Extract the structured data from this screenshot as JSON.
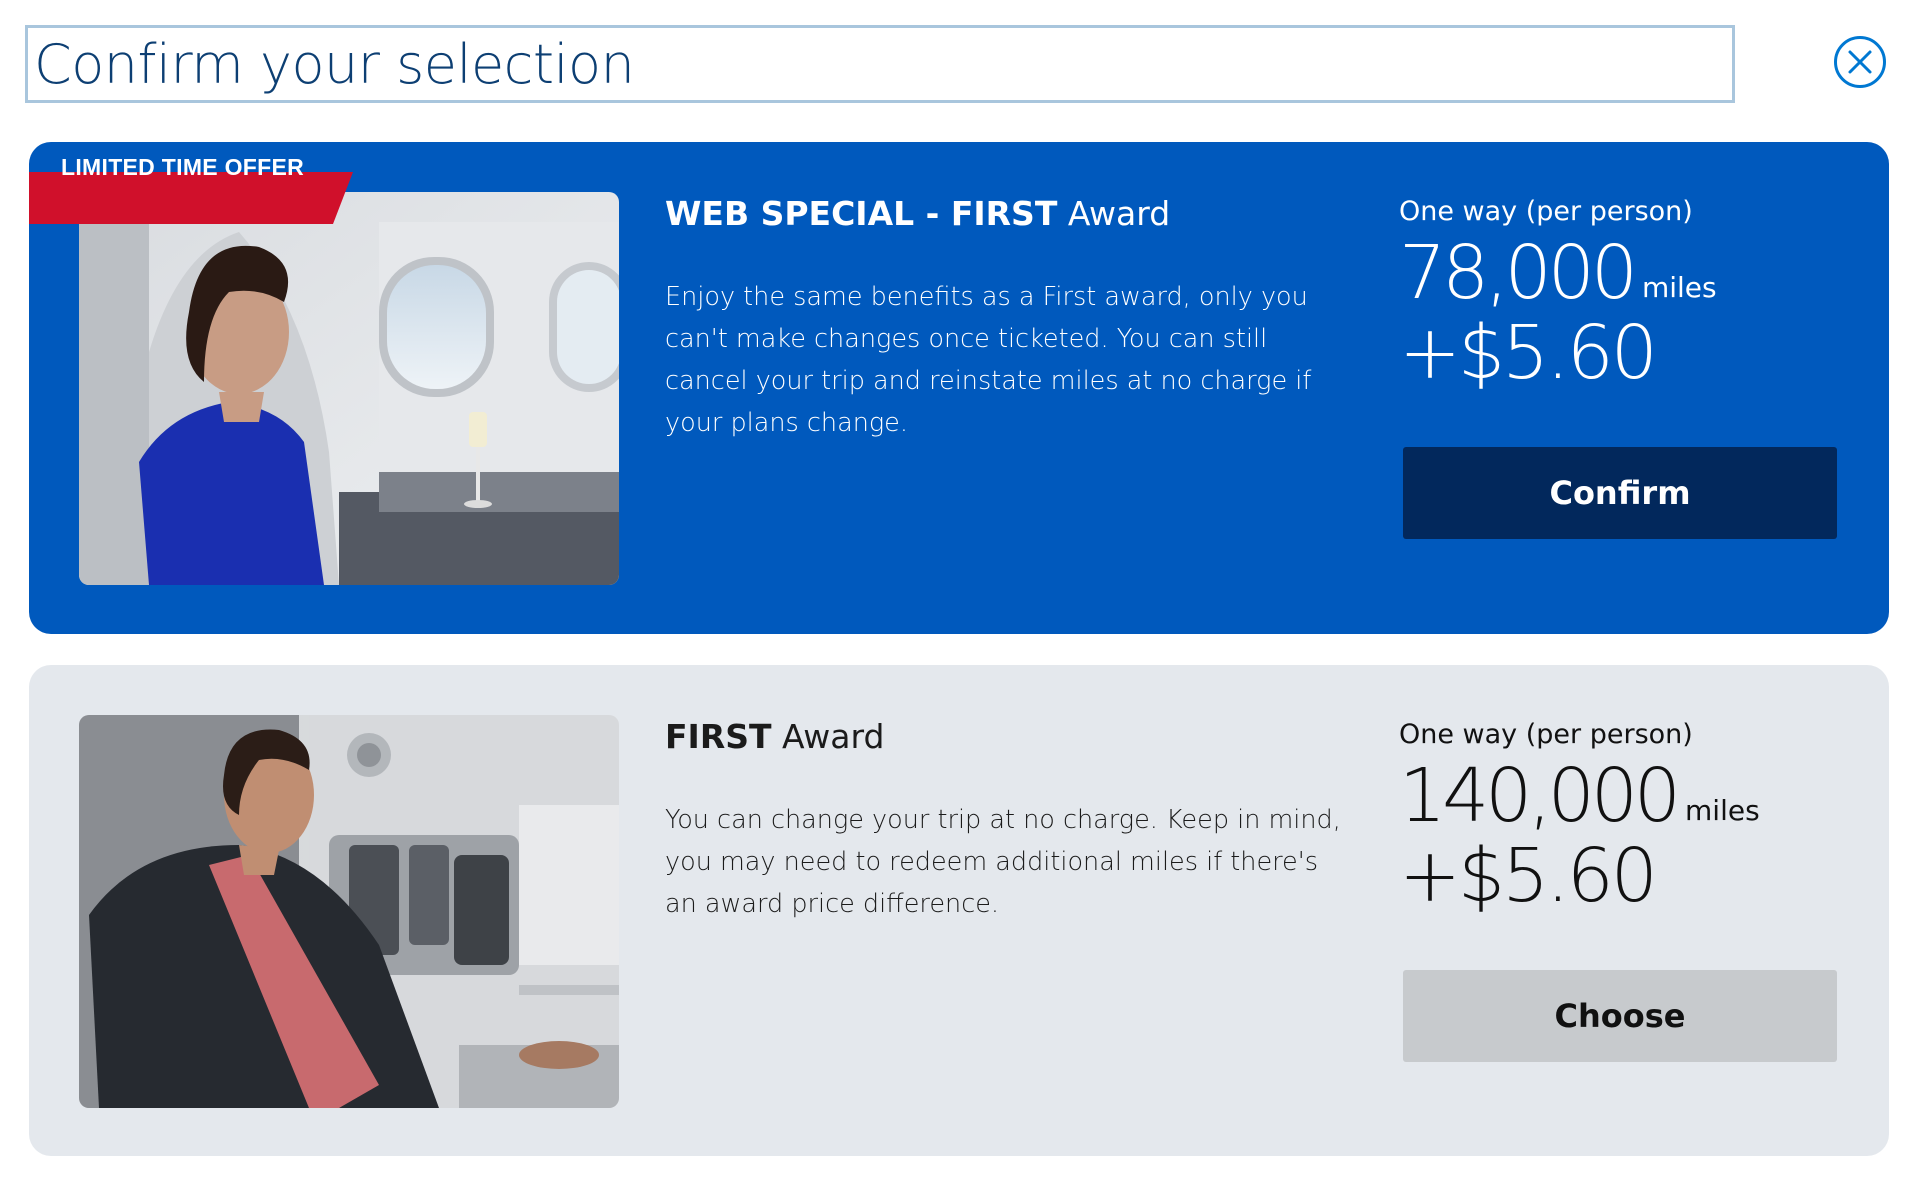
{
  "dialog": {
    "title": "Confirm your selection",
    "close_icon": "close-circle-icon"
  },
  "colors": {
    "title_text": "#0d3f73",
    "title_border": "#a9c6dd",
    "special_card_bg": "#0059bd",
    "first_card_bg": "#e4e8ed",
    "confirm_button_bg": "#02285c",
    "choose_button_bg": "#c7cacd",
    "ribbon_red": "#d0102b"
  },
  "offers": [
    {
      "ribbon": "LIMITED TIME OFFER",
      "title_strong": "WEB SPECIAL - FIRST",
      "title_light": " Award",
      "description": "Enjoy the same benefits as a First award, only you can't make changes once ticketed. You can still cancel your trip and reinstate miles at no charge if your plans change.",
      "price_label": "One way (per person)",
      "miles": "78,000",
      "miles_unit": "miles",
      "fee": "+$5.60",
      "button_label": "Confirm"
    },
    {
      "title_strong": "FIRST",
      "title_light": " Award",
      "description": "You can change your trip at no charge. Keep in mind, you may need to redeem additional miles if there's an award price difference.",
      "price_label": "One way (per person)",
      "miles": "140,000",
      "miles_unit": "miles",
      "fee": "+$5.60",
      "button_label": "Choose"
    }
  ]
}
